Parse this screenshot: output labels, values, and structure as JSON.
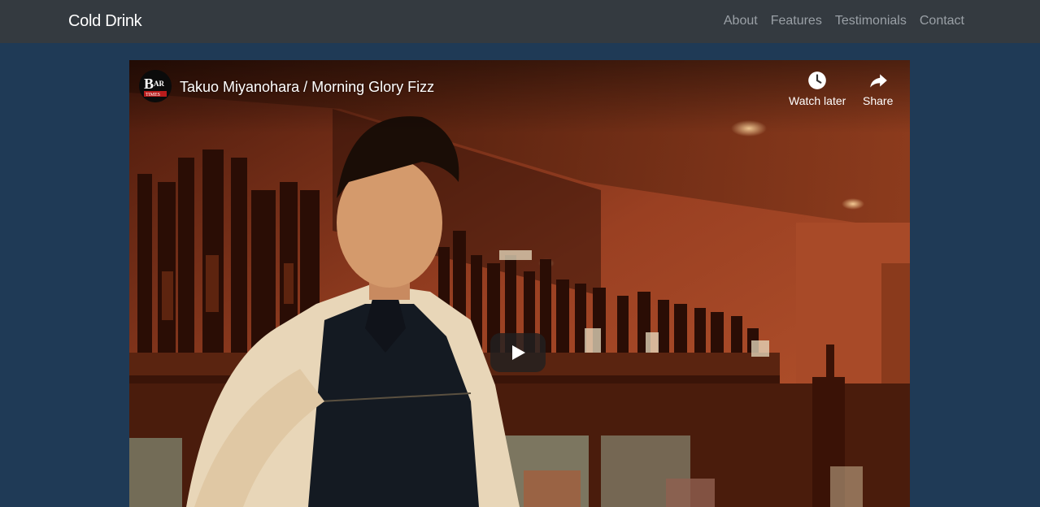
{
  "navbar": {
    "brand": "Cold Drink",
    "links": [
      {
        "label": "About"
      },
      {
        "label": "Features"
      },
      {
        "label": "Testimonials"
      },
      {
        "label": "Contact"
      }
    ]
  },
  "video": {
    "title": "Takuo Miyanohara / Morning Glory Fizz",
    "channel_logo_text": "BAR TIMES",
    "watch_later_label": "Watch later",
    "share_label": "Share",
    "watch_later_icon": "clock-icon",
    "share_icon": "share-arrow-icon",
    "play_icon": "play-icon"
  },
  "colors": {
    "page_background": "#1f3a56",
    "navbar_background": "#343a40",
    "brand_text": "#ffffff",
    "nav_link_text": "#9aa0a6"
  }
}
